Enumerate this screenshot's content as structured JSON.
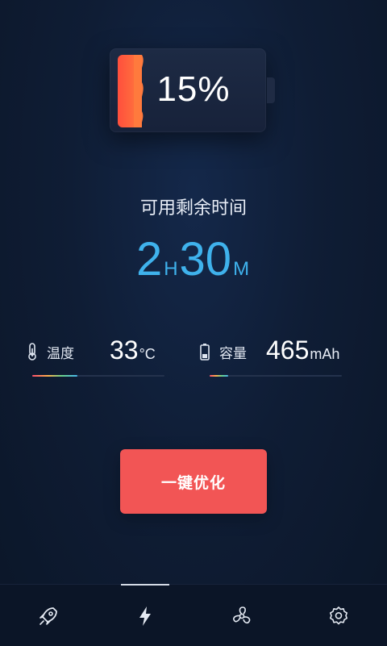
{
  "battery": {
    "percent_text": "15%",
    "level_percent": 15
  },
  "remaining": {
    "label": "可用剩余时间",
    "hours": "2",
    "hours_unit": "H",
    "minutes": "30",
    "minutes_unit": "M"
  },
  "stats": {
    "temperature": {
      "icon": "thermometer-icon",
      "label": "温度",
      "value": "33",
      "unit": "°C",
      "level_percent": 34
    },
    "capacity": {
      "icon": "battery-icon",
      "label": "容量",
      "value": "465",
      "unit": "mAh",
      "level_percent": 14
    }
  },
  "optimize_button": {
    "label": "一键优化"
  },
  "tabbar": {
    "active_index": 1,
    "tabs": [
      {
        "icon": "rocket-icon"
      },
      {
        "icon": "lightning-icon"
      },
      {
        "icon": "fan-icon"
      },
      {
        "icon": "gear-icon"
      }
    ]
  },
  "colors": {
    "accent_blue": "#3fb2ec",
    "button_red": "#f25555",
    "battery_fill": "#ff5a3d"
  }
}
